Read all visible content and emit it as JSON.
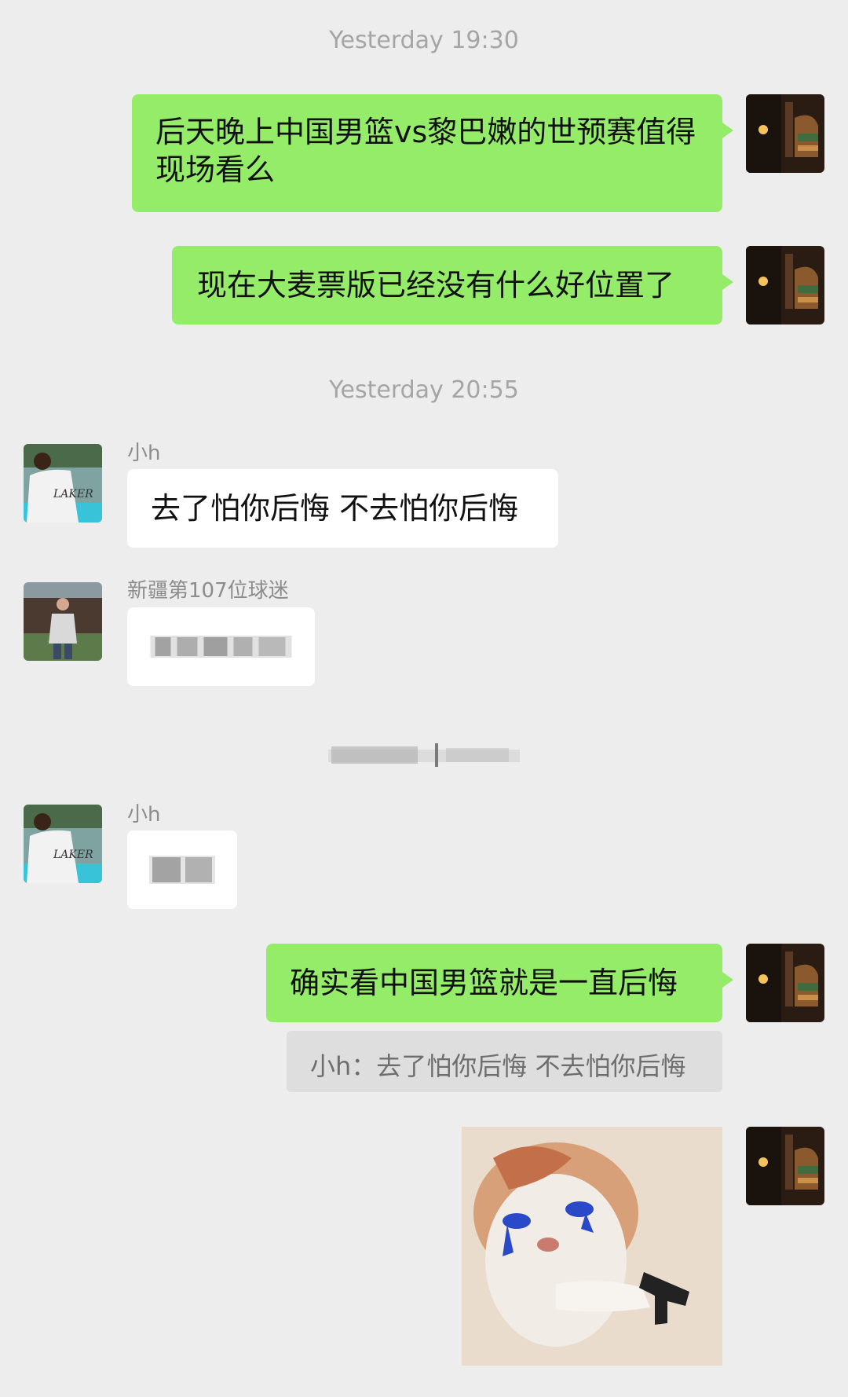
{
  "timestamps": [
    "Yesterday 19:30",
    "Yesterday 20:55"
  ],
  "messages": {
    "m1": "后天晚上中国男篮vs黎巴嫩的世预赛值得现场看么",
    "m2": "现在大麦票版已经没有什么好位置了",
    "m3": "去了怕你后悔 不去怕你后悔",
    "m6": "确实看中国男篮就是一直后悔",
    "quote": "小h：去了怕你后悔 不去怕你后悔"
  },
  "senders": {
    "h": "小h",
    "xj": "新疆第107位球迷"
  },
  "colors": {
    "background": "#ededed",
    "my_bubble": "#95ec69",
    "other_bubble": "#ffffff",
    "timestamp_text": "#a5a5a5"
  },
  "icons": {
    "my_avatar": "dark-room-avatar-icon",
    "h_avatar": "lakers-shirt-avatar-icon",
    "xj_avatar": "standing-person-avatar-icon",
    "sticker": "crying-cat-with-gun-sticker"
  }
}
